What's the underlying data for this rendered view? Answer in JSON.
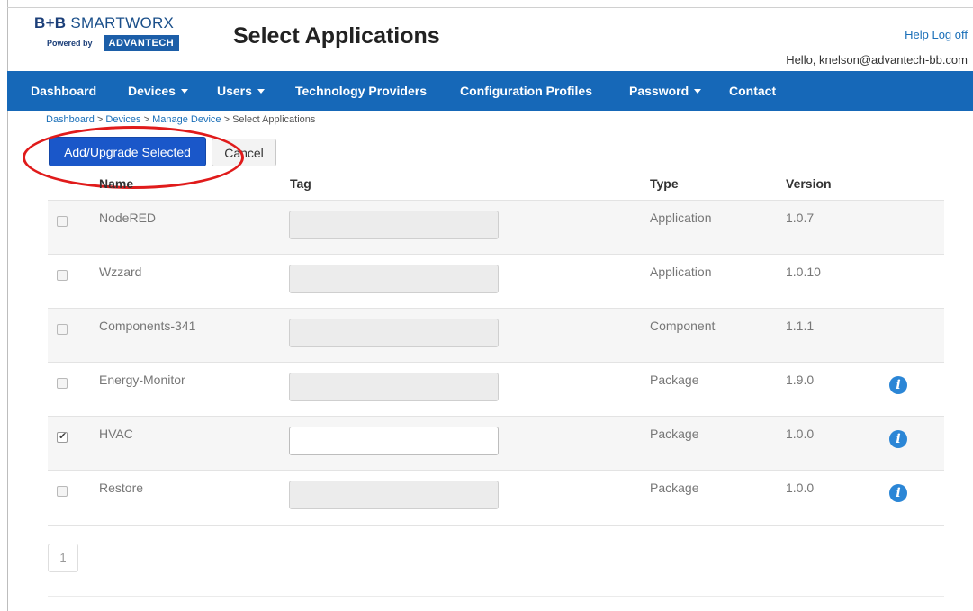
{
  "logo": {
    "brand_prefix": "B+B",
    "brand_name": "SMARTWORX",
    "powered_by": "Powered by",
    "partner": "ADVANTECH"
  },
  "header": {
    "title": "Select Applications",
    "help_label": "Help",
    "logoff_label": "Log off",
    "greeting": "Hello, knelson@advantech-bb.com"
  },
  "nav": {
    "items": [
      {
        "label": "Dashboard",
        "dropdown": false
      },
      {
        "label": "Devices",
        "dropdown": true
      },
      {
        "label": "Users",
        "dropdown": true
      },
      {
        "label": "Technology Providers",
        "dropdown": false
      },
      {
        "label": "Configuration Profiles",
        "dropdown": false
      },
      {
        "label": "Password",
        "dropdown": true
      },
      {
        "label": "Contact",
        "dropdown": false
      }
    ]
  },
  "breadcrumb": {
    "items": [
      "Dashboard",
      "Devices",
      "Manage Device"
    ],
    "current": "Select Applications",
    "separator": ">"
  },
  "actions": {
    "add_label": "Add/Upgrade Selected",
    "cancel_label": "Cancel"
  },
  "table": {
    "columns": [
      "Name",
      "Tag",
      "Type",
      "Version"
    ],
    "rows": [
      {
        "name": "NodeRED",
        "tag": "",
        "type": "Application",
        "version": "1.0.7",
        "checked": false,
        "info": false
      },
      {
        "name": "Wzzard",
        "tag": "",
        "type": "Application",
        "version": "1.0.10",
        "checked": false,
        "info": false
      },
      {
        "name": "Components-341",
        "tag": "",
        "type": "Component",
        "version": "1.1.1",
        "checked": false,
        "info": false
      },
      {
        "name": "Energy-Monitor",
        "tag": "",
        "type": "Package",
        "version": "1.9.0",
        "checked": false,
        "info": true
      },
      {
        "name": "HVAC",
        "tag": "",
        "type": "Package",
        "version": "1.0.0",
        "checked": true,
        "info": true
      },
      {
        "name": "Restore",
        "tag": "",
        "type": "Package",
        "version": "1.0.0",
        "checked": false,
        "info": true
      }
    ]
  },
  "pagination": {
    "current_page": "1"
  },
  "colors": {
    "navbar": "#1668b8",
    "primary_button": "#1a57c9",
    "link": "#1a6fb8",
    "annotation_ellipse": "#e01b1b",
    "info_icon": "#2b86d6"
  }
}
